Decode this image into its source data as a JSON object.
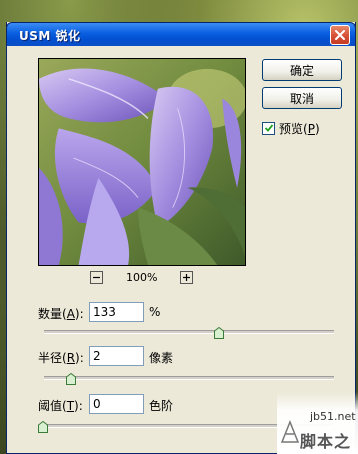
{
  "window": {
    "title": "USM 锐化"
  },
  "buttons": {
    "ok": "确定",
    "cancel": "取消"
  },
  "preview_toggle": {
    "label": "预览(",
    "mnemonic": "P",
    "suffix": ")",
    "checked": true
  },
  "zoom": {
    "level": "100%"
  },
  "params": {
    "amount": {
      "label_pre": "数量(",
      "mnemonic": "A",
      "label_post": "):",
      "value": "133",
      "unit": "%",
      "slider_fraction": 0.63
    },
    "radius": {
      "label_pre": "半径(",
      "mnemonic": "R",
      "label_post": "):",
      "value": "2",
      "unit": "像素",
      "slider_fraction": 0.1
    },
    "threshold": {
      "label_pre": "阈值(",
      "mnemonic": "T",
      "label_post": "):",
      "value": "0",
      "unit": "色阶",
      "slider_fraction": 0.0
    }
  },
  "watermark": {
    "site": "jb51.net",
    "name": "脚本之家"
  },
  "icons": {
    "close": "close-icon",
    "zoom_out": "zoom-out-icon",
    "zoom_in": "zoom-in-icon",
    "check": "check-icon",
    "slider_thumb": "slider-thumb-icon"
  }
}
